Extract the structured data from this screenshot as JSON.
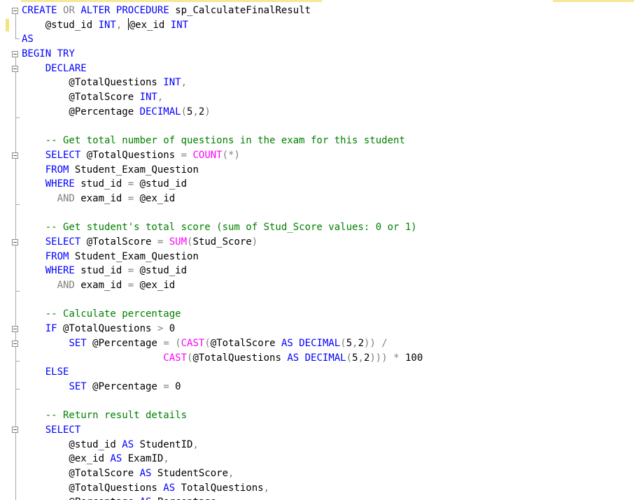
{
  "colors": {
    "keyword": "#0000ff",
    "function": "#ff00ff",
    "operator": "#808080",
    "comment": "#008000",
    "text": "#000000"
  },
  "lines": [
    [
      {
        "t": "CREATE",
        "c": "kw"
      },
      {
        "t": " ",
        "c": "tx"
      },
      {
        "t": "OR",
        "c": "op"
      },
      {
        "t": " ",
        "c": "tx"
      },
      {
        "t": "ALTER",
        "c": "kw"
      },
      {
        "t": " ",
        "c": "tx"
      },
      {
        "t": "PROCEDURE",
        "c": "kw"
      },
      {
        "t": " sp_CalculateFinalResult",
        "c": "tx"
      }
    ],
    [
      {
        "t": "    @stud_id ",
        "c": "tx"
      },
      {
        "t": "INT",
        "c": "kw"
      },
      {
        "t": ",",
        "c": "op"
      },
      {
        "t": " ",
        "c": "tx"
      },
      {
        "caret": true
      },
      {
        "t": "@ex_id ",
        "c": "tx"
      },
      {
        "t": "INT",
        "c": "kw"
      }
    ],
    [
      {
        "t": "AS",
        "c": "kw"
      }
    ],
    [
      {
        "t": "BEGIN",
        "c": "kw"
      },
      {
        "t": " ",
        "c": "tx"
      },
      {
        "t": "TRY",
        "c": "kw"
      }
    ],
    [
      {
        "t": "    ",
        "c": "tx"
      },
      {
        "t": "DECLARE",
        "c": "kw"
      }
    ],
    [
      {
        "t": "        @TotalQuestions ",
        "c": "tx"
      },
      {
        "t": "INT",
        "c": "kw"
      },
      {
        "t": ",",
        "c": "op"
      }
    ],
    [
      {
        "t": "        @TotalScore ",
        "c": "tx"
      },
      {
        "t": "INT",
        "c": "kw"
      },
      {
        "t": ",",
        "c": "op"
      }
    ],
    [
      {
        "t": "        @Percentage ",
        "c": "tx"
      },
      {
        "t": "DECIMAL",
        "c": "kw"
      },
      {
        "t": "(",
        "c": "op"
      },
      {
        "t": "5",
        "c": "tx"
      },
      {
        "t": ",",
        "c": "op"
      },
      {
        "t": "2",
        "c": "tx"
      },
      {
        "t": ")",
        "c": "op"
      }
    ],
    [],
    [
      {
        "t": "    -- Get total number of questions in the exam for this student",
        "c": "cm"
      }
    ],
    [
      {
        "t": "    ",
        "c": "tx"
      },
      {
        "t": "SELECT",
        "c": "kw"
      },
      {
        "t": " @TotalQuestions ",
        "c": "tx"
      },
      {
        "t": "=",
        "c": "op"
      },
      {
        "t": " ",
        "c": "tx"
      },
      {
        "t": "COUNT",
        "c": "fn"
      },
      {
        "t": "(*)",
        "c": "op"
      }
    ],
    [
      {
        "t": "    ",
        "c": "tx"
      },
      {
        "t": "FROM",
        "c": "kw"
      },
      {
        "t": " Student_Exam_Question",
        "c": "tx"
      }
    ],
    [
      {
        "t": "    ",
        "c": "tx"
      },
      {
        "t": "WHERE",
        "c": "kw"
      },
      {
        "t": " stud_id ",
        "c": "tx"
      },
      {
        "t": "=",
        "c": "op"
      },
      {
        "t": " @stud_id",
        "c": "tx"
      }
    ],
    [
      {
        "t": "      ",
        "c": "tx"
      },
      {
        "t": "AND",
        "c": "op"
      },
      {
        "t": " exam_id ",
        "c": "tx"
      },
      {
        "t": "=",
        "c": "op"
      },
      {
        "t": " @ex_id",
        "c": "tx"
      }
    ],
    [],
    [
      {
        "t": "    -- Get student's total score (sum of Stud_Score values: 0 or 1)",
        "c": "cm"
      }
    ],
    [
      {
        "t": "    ",
        "c": "tx"
      },
      {
        "t": "SELECT",
        "c": "kw"
      },
      {
        "t": " @TotalScore ",
        "c": "tx"
      },
      {
        "t": "=",
        "c": "op"
      },
      {
        "t": " ",
        "c": "tx"
      },
      {
        "t": "SUM",
        "c": "fn"
      },
      {
        "t": "(",
        "c": "op"
      },
      {
        "t": "Stud_Score",
        "c": "tx"
      },
      {
        "t": ")",
        "c": "op"
      }
    ],
    [
      {
        "t": "    ",
        "c": "tx"
      },
      {
        "t": "FROM",
        "c": "kw"
      },
      {
        "t": " Student_Exam_Question",
        "c": "tx"
      }
    ],
    [
      {
        "t": "    ",
        "c": "tx"
      },
      {
        "t": "WHERE",
        "c": "kw"
      },
      {
        "t": " stud_id ",
        "c": "tx"
      },
      {
        "t": "=",
        "c": "op"
      },
      {
        "t": " @stud_id",
        "c": "tx"
      }
    ],
    [
      {
        "t": "      ",
        "c": "tx"
      },
      {
        "t": "AND",
        "c": "op"
      },
      {
        "t": " exam_id ",
        "c": "tx"
      },
      {
        "t": "=",
        "c": "op"
      },
      {
        "t": " @ex_id",
        "c": "tx"
      }
    ],
    [],
    [
      {
        "t": "    -- Calculate percentage",
        "c": "cm"
      }
    ],
    [
      {
        "t": "    ",
        "c": "tx"
      },
      {
        "t": "IF",
        "c": "kw"
      },
      {
        "t": " @TotalQuestions ",
        "c": "tx"
      },
      {
        "t": ">",
        "c": "op"
      },
      {
        "t": " 0",
        "c": "tx"
      }
    ],
    [
      {
        "t": "        ",
        "c": "tx"
      },
      {
        "t": "SET",
        "c": "kw"
      },
      {
        "t": " @Percentage ",
        "c": "tx"
      },
      {
        "t": "=",
        "c": "op"
      },
      {
        "t": " ",
        "c": "tx"
      },
      {
        "t": "(",
        "c": "op"
      },
      {
        "t": "CAST",
        "c": "fn"
      },
      {
        "t": "(",
        "c": "op"
      },
      {
        "t": "@TotalScore ",
        "c": "tx"
      },
      {
        "t": "AS",
        "c": "kw"
      },
      {
        "t": " ",
        "c": "tx"
      },
      {
        "t": "DECIMAL",
        "c": "kw"
      },
      {
        "t": "(",
        "c": "op"
      },
      {
        "t": "5",
        "c": "tx"
      },
      {
        "t": ",",
        "c": "op"
      },
      {
        "t": "2",
        "c": "tx"
      },
      {
        "t": "))",
        "c": "op"
      },
      {
        "t": " ",
        "c": "tx"
      },
      {
        "t": "/",
        "c": "op"
      }
    ],
    [
      {
        "t": "                        ",
        "c": "tx"
      },
      {
        "t": "CAST",
        "c": "fn"
      },
      {
        "t": "(",
        "c": "op"
      },
      {
        "t": "@TotalQuestions ",
        "c": "tx"
      },
      {
        "t": "AS",
        "c": "kw"
      },
      {
        "t": " ",
        "c": "tx"
      },
      {
        "t": "DECIMAL",
        "c": "kw"
      },
      {
        "t": "(",
        "c": "op"
      },
      {
        "t": "5",
        "c": "tx"
      },
      {
        "t": ",",
        "c": "op"
      },
      {
        "t": "2",
        "c": "tx"
      },
      {
        "t": ")))",
        "c": "op"
      },
      {
        "t": " ",
        "c": "tx"
      },
      {
        "t": "*",
        "c": "op"
      },
      {
        "t": " 100",
        "c": "tx"
      }
    ],
    [
      {
        "t": "    ",
        "c": "tx"
      },
      {
        "t": "ELSE",
        "c": "kw"
      }
    ],
    [
      {
        "t": "        ",
        "c": "tx"
      },
      {
        "t": "SET",
        "c": "kw"
      },
      {
        "t": " @Percentage ",
        "c": "tx"
      },
      {
        "t": "=",
        "c": "op"
      },
      {
        "t": " 0",
        "c": "tx"
      }
    ],
    [],
    [
      {
        "t": "    -- Return result details",
        "c": "cm"
      }
    ],
    [
      {
        "t": "    ",
        "c": "tx"
      },
      {
        "t": "SELECT",
        "c": "kw"
      }
    ],
    [
      {
        "t": "        @stud_id ",
        "c": "tx"
      },
      {
        "t": "AS",
        "c": "kw"
      },
      {
        "t": " StudentID",
        "c": "tx"
      },
      {
        "t": ",",
        "c": "op"
      }
    ],
    [
      {
        "t": "        @ex_id ",
        "c": "tx"
      },
      {
        "t": "AS",
        "c": "kw"
      },
      {
        "t": " ExamID",
        "c": "tx"
      },
      {
        "t": ",",
        "c": "op"
      }
    ],
    [
      {
        "t": "        @TotalScore ",
        "c": "tx"
      },
      {
        "t": "AS",
        "c": "kw"
      },
      {
        "t": " StudentScore",
        "c": "tx"
      },
      {
        "t": ",",
        "c": "op"
      }
    ],
    [
      {
        "t": "        @TotalQuestions ",
        "c": "tx"
      },
      {
        "t": "AS",
        "c": "kw"
      },
      {
        "t": " TotalQuestions",
        "c": "tx"
      },
      {
        "t": ",",
        "c": "op"
      }
    ],
    [
      {
        "t": "        @Percentage ",
        "c": "tx"
      },
      {
        "t": "AS",
        "c": "kw"
      },
      {
        "t": " Percentage",
        "c": "tx"
      },
      {
        "t": ",",
        "c": "op"
      }
    ]
  ]
}
